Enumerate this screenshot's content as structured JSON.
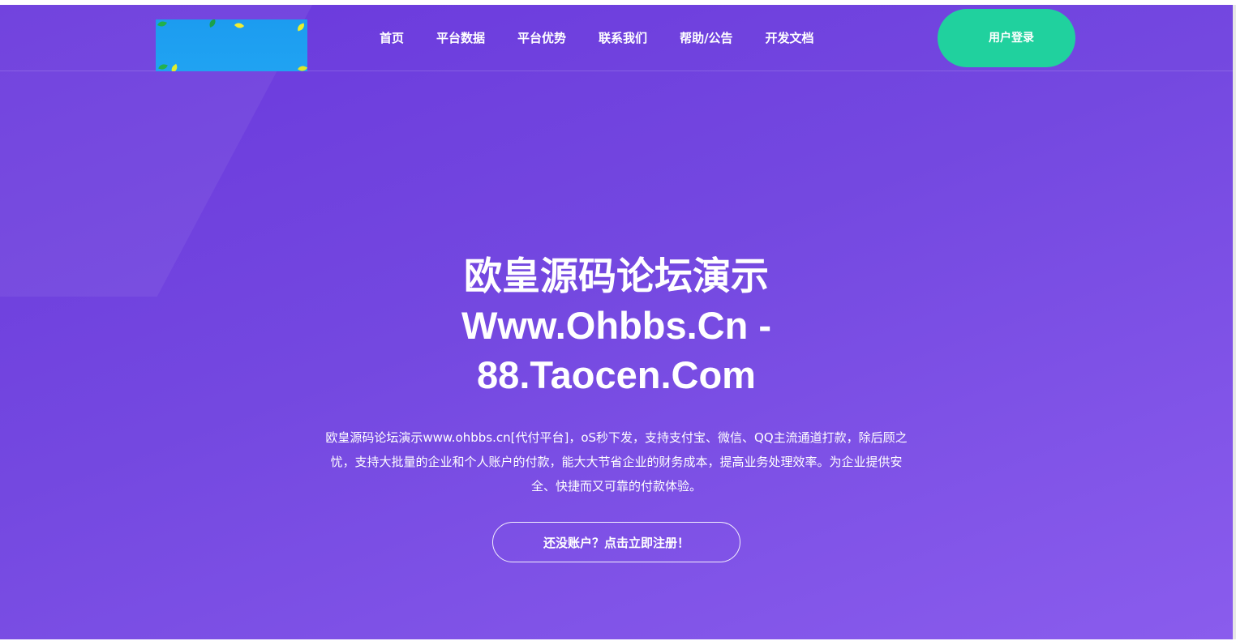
{
  "header": {
    "nav": [
      {
        "label": "首页"
      },
      {
        "label": "平台数据"
      },
      {
        "label": "平台优势"
      },
      {
        "label": "联系我们"
      },
      {
        "label": "帮助/公告"
      },
      {
        "label": "开发文档"
      }
    ],
    "login_label": "用户登录"
  },
  "hero": {
    "title_line1": "欧皇源码论坛演示",
    "title_line2": "Www.Ohbbs.Cn -",
    "title_line3": "88.Taocen.Com",
    "description": "欧皇源码论坛演示www.ohbbs.cn[代付平台]，oS秒下发，支持支付宝、微信、QQ主流通道打款，除后顾之忧，支持大批量的企业和个人账户的付款，能大大节省企业的财务成本，提高业务处理效率。为企业提供安全、快捷而又可靠的付款体验。",
    "register_label": "还没账户？点击立即注册！"
  },
  "colors": {
    "background_start": "#6a38dc",
    "background_end": "#8a5ced",
    "login_button": "#20d19e",
    "logo_blue": "#1c9cf0"
  }
}
